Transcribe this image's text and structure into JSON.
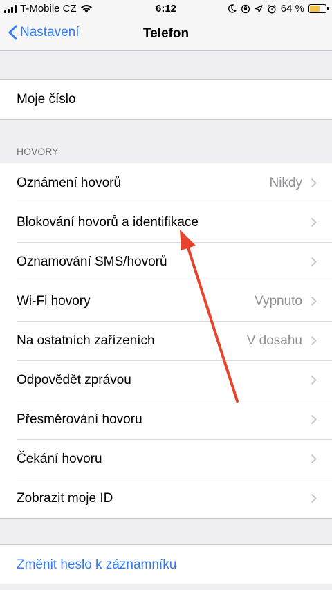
{
  "status_bar": {
    "carrier": "T-Mobile CZ",
    "time": "6:12",
    "battery_text": "64 %",
    "battery_level": 0.64
  },
  "nav": {
    "back_label": "Nastavení",
    "title": "Telefon"
  },
  "group_number": {
    "items": [
      {
        "label": "Moje číslo"
      }
    ]
  },
  "calls": {
    "header": "HOVORY",
    "items": [
      {
        "label": "Oznámení hovorů",
        "value": "Nikdy"
      },
      {
        "label": "Blokování hovorů a identifikace",
        "value": ""
      },
      {
        "label": "Oznamování SMS/hovorů",
        "value": ""
      },
      {
        "label": "Wi-Fi hovory",
        "value": "Vypnuto"
      },
      {
        "label": "Na ostatních zařízeních",
        "value": "V dosahu"
      },
      {
        "label": "Odpovědět zprávou",
        "value": ""
      },
      {
        "label": "Přesměrování hovoru",
        "value": ""
      },
      {
        "label": "Čekání hovoru",
        "value": ""
      },
      {
        "label": "Zobrazit moje ID",
        "value": ""
      }
    ]
  },
  "voicemail": {
    "change_password_label": "Změnit heslo k záznamníku"
  },
  "colors": {
    "accent": "#2f7cf6",
    "annotation_arrow": "#e8432c",
    "background": "#efeff4"
  }
}
